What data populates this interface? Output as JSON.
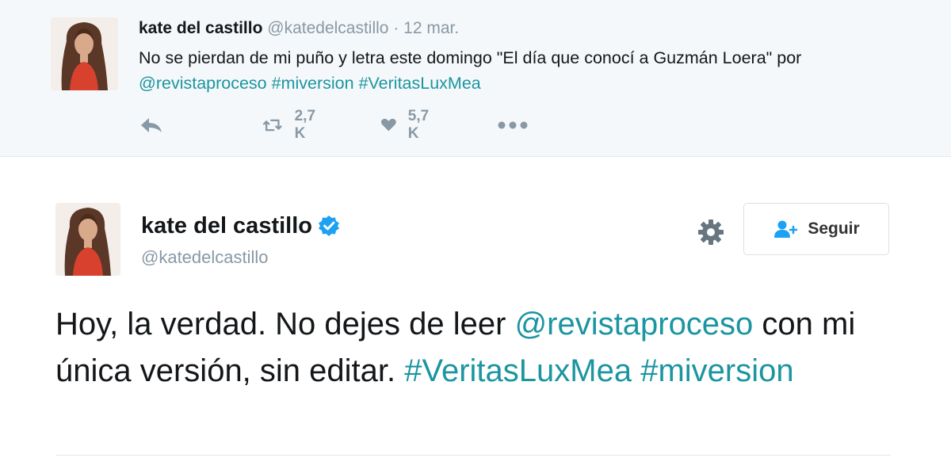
{
  "tweet1": {
    "name": "kate del castillo",
    "handle": "@katedelcastillo",
    "separator": "·",
    "date": "12 mar.",
    "text_before": "No se pierdan de mi puño y letra este domingo \"El día que conocí a Guzmán Loera\" por ",
    "mention": "@revistaproceso",
    "hashtag1": "#miversion",
    "hashtag2": "#VeritasLuxMea",
    "retweet_count": "2,7 K",
    "like_count": "5,7 K"
  },
  "tweet2": {
    "name": "kate del castillo",
    "handle": "@katedelcastillo",
    "follow_label": "Seguir",
    "text_before": "Hoy, la verdad. No dejes de leer ",
    "mention": "@revistaproceso",
    "text_middle": " con mi única versión, sin editar. ",
    "hashtag1": "#VeritasLuxMea",
    "hashtag2": "#miversion"
  },
  "icons": {
    "reply": "reply-icon",
    "retweet": "retweet-icon",
    "like": "heart-icon",
    "more": "more-icon",
    "verified": "verified-badge-icon",
    "settings": "gear-icon",
    "follow": "add-user-icon"
  },
  "colors": {
    "link": "#1b95a0",
    "secondary_text": "#8899a6",
    "verified": "#1da1f2",
    "top_background": "#f5f8fa"
  }
}
